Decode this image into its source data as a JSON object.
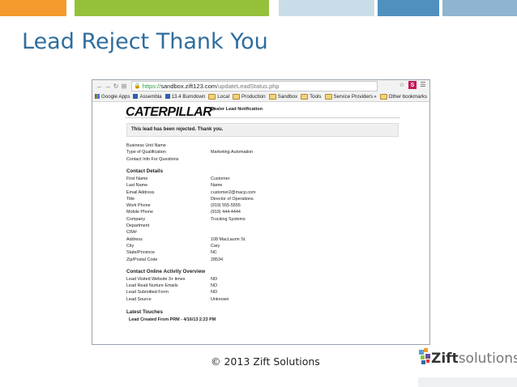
{
  "colors": {
    "topbar": [
      "#f39c2d",
      "#a7c64b",
      "#95c13a",
      "#c9dde8",
      "#4f90bf",
      "#8fb4cf"
    ],
    "title": "#2f6d9d"
  },
  "slide": {
    "title": "Lead Reject Thank You",
    "footer": "© 2013 Zift Solutions"
  },
  "brand": {
    "bold": "Zift",
    "light": "solutions"
  },
  "browser": {
    "nav": {
      "back_icon": "back-arrow-icon",
      "forward_icon": "forward-arrow-icon",
      "reload_icon": "reload-icon",
      "apps_icon": "apps-grid-icon"
    },
    "url": {
      "scheme": "https://",
      "host": "sandbox.zift123.com",
      "path": "/updateLeadStatus.php"
    },
    "star_icon": "star-icon",
    "ext_badge": "S",
    "menu_icon": "menu-icon",
    "bookmarks": [
      {
        "label": "Google Apps",
        "icon": "apps"
      },
      {
        "label": "Assembla",
        "icon": "jira"
      },
      {
        "label": "13.4 Burndown",
        "icon": "jira"
      },
      {
        "label": "Local",
        "icon": "folder"
      },
      {
        "label": "Production",
        "icon": "folder"
      },
      {
        "label": "Sandbox",
        "icon": "folder"
      },
      {
        "label": "Tools",
        "icon": "folder"
      },
      {
        "label": "Service Providers",
        "icon": "folder"
      }
    ],
    "more_bookmarks": "»",
    "other_bookmarks": "Other bookmarks"
  },
  "page": {
    "logo": "CATERPILLAR",
    "logo_mark": "®",
    "heading": "Dealer Lead Notification",
    "message": "This lead has been rejected. Thank you.",
    "intro": [
      {
        "label": "Business Unit Name",
        "value": ""
      },
      {
        "label": "Type of Qualification",
        "value": "Marketing Automation"
      },
      {
        "label": "Contact Info For Questions",
        "value": ""
      }
    ],
    "contact_title": "Contact Details",
    "contact": [
      {
        "label": "First Name",
        "value": "Customer"
      },
      {
        "label": "Last Name",
        "value": "Name"
      },
      {
        "label": "Email Address",
        "value": "customer2@macp.com"
      },
      {
        "label": "Title",
        "value": "Director of Operations"
      },
      {
        "label": "Work Phone",
        "value": "(919) 555-5555"
      },
      {
        "label": "Mobile Phone",
        "value": "(919) 444-4444"
      },
      {
        "label": "Company",
        "value": "Trucking Systems"
      },
      {
        "label": "Department",
        "value": ""
      },
      {
        "label": "CIM#",
        "value": ""
      },
      {
        "label": "Address",
        "value": "108 MacLaurin St."
      },
      {
        "label": "City",
        "value": "Cary"
      },
      {
        "label": "State/Province",
        "value": "NC"
      },
      {
        "label": "Zip/Postal Code",
        "value": "28534"
      }
    ],
    "activity_title": "Contact Online Activity Overview",
    "activity": [
      {
        "label": "Lead Visited Website 3+ times",
        "value": "NO"
      },
      {
        "label": "Lead Read Nurture Emails",
        "value": "NO"
      },
      {
        "label": "Lead Submitted Form",
        "value": "NO"
      },
      {
        "label": "Lead Source",
        "value": "Unknown"
      }
    ],
    "touches_title": "Latest Touches",
    "touch": "Lead Created From PRM - 4/16/13 2:23 PM"
  }
}
